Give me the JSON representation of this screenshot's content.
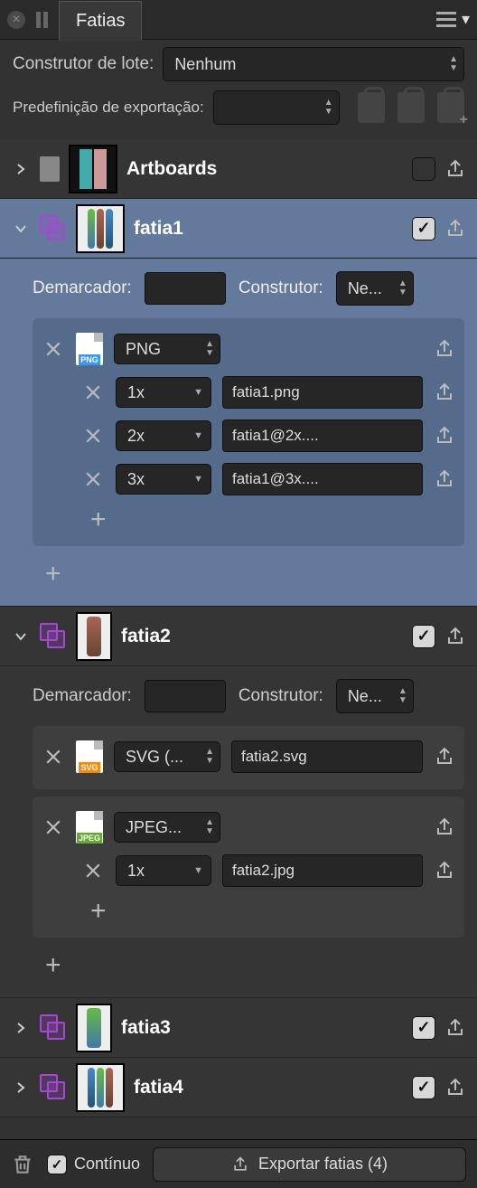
{
  "tab_title": "Fatias",
  "batch_builder_label": "Construtor de lote:",
  "batch_builder_value": "Nenhum",
  "export_preset_label": "Predefinição de exportação:",
  "export_preset_value": "",
  "demarcador_label": "Demarcador:",
  "construtor_label": "Construtor:",
  "construtor_value": "Ne...",
  "artboards": {
    "title": "Artboards"
  },
  "slices": [
    {
      "name": "fatia1",
      "selected": true,
      "expanded": true,
      "checked": true,
      "formats": [
        {
          "type": "PNG",
          "type_label": "PNG",
          "scales": [
            {
              "scale": "1x",
              "filename": "fatia1.png"
            },
            {
              "scale": "2x",
              "filename": "fatia1@2x...."
            },
            {
              "scale": "3x",
              "filename": "fatia1@3x...."
            }
          ]
        }
      ]
    },
    {
      "name": "fatia2",
      "selected": false,
      "expanded": true,
      "checked": true,
      "formats": [
        {
          "type": "SVG",
          "type_label": "SVG (...",
          "filename": "fatia2.svg"
        },
        {
          "type": "JPEG",
          "type_label": "JPEG...",
          "scales": [
            {
              "scale": "1x",
              "filename": "fatia2.jpg"
            }
          ]
        }
      ]
    },
    {
      "name": "fatia3",
      "selected": false,
      "expanded": false,
      "checked": true
    },
    {
      "name": "fatia4",
      "selected": false,
      "expanded": false,
      "checked": true
    }
  ],
  "footer": {
    "continuous_label": "Contínuo",
    "continuous_checked": true,
    "export_label": "Exportar fatias (4)"
  }
}
